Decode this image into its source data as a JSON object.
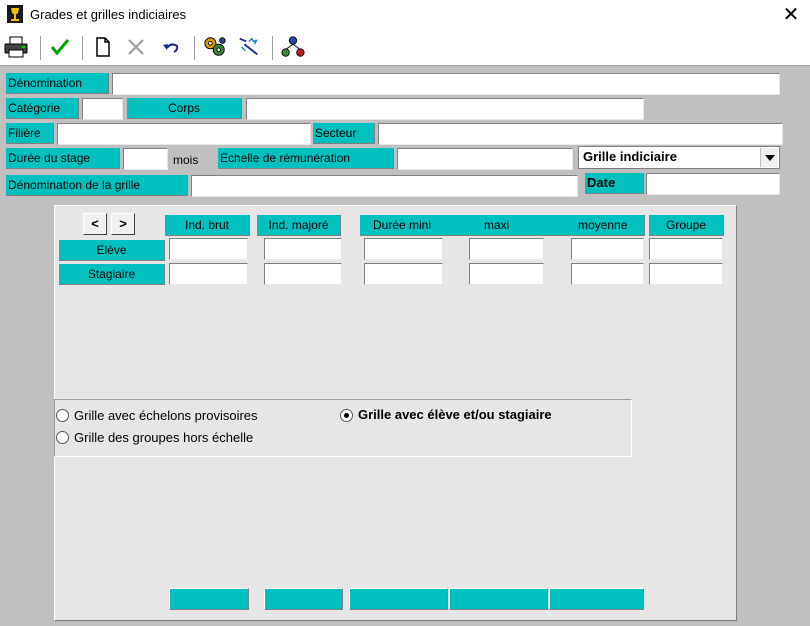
{
  "window": {
    "title": "Grades et grilles indiciaires"
  },
  "colors": {
    "label_bg": "#00c0c0",
    "form_bg": "#c0c0c0",
    "panel_bg": "#e6e6e6"
  },
  "toolbar": {
    "icons": [
      "printer-icon",
      "check-icon",
      "new-document-icon",
      "delete-icon",
      "undo-icon",
      "gear-cluster-icon",
      "wand-icon",
      "network-icon"
    ]
  },
  "form": {
    "denomination_label": "Dénomination",
    "denomination_value": "",
    "categorie_label": "Catégorie",
    "categorie_value": "",
    "corps_label": "Corps",
    "corps_value": "",
    "filiere_label": "Filière",
    "filiere_value": "",
    "secteur_label": "Secteur",
    "secteur_value": "",
    "duree_stage_label": "Durée du stage",
    "duree_stage_value": "",
    "mois_text": "mois",
    "echelle_label": "Echelle de rémunération",
    "echelle_value": "",
    "grille_select_value": "Grille indiciaire",
    "denomination_grille_label": "Dénomination de la grille",
    "denomination_grille_value": "",
    "date_label": "Date",
    "date_value": ""
  },
  "grid": {
    "prev_label": "<",
    "next_label": ">",
    "headers": {
      "ind_brut": "Ind. brut",
      "ind_majore": "Ind. majoré",
      "duree_mini": "Durée mini",
      "maxi": "maxi",
      "moyenne": "moyenne",
      "groupe": "Groupe"
    },
    "rows": [
      {
        "label": "Elève"
      },
      {
        "label": "Stagiaire"
      }
    ]
  },
  "options": {
    "echelons_provisoires": "Grille avec échelons provisoires",
    "groupes_hors_echelle": "Grille des groupes hors échelle",
    "eleve_stagiaire": "Grille avec élève et/ou stagiaire",
    "selected": "eleve_stagiaire"
  }
}
